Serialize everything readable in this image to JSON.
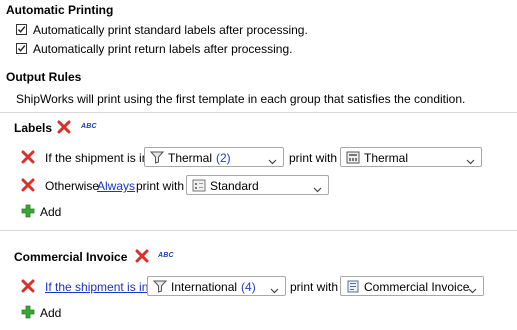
{
  "automatic_printing": {
    "heading": "Automatic Printing",
    "options": [
      {
        "label": "Automatically print standard labels after processing.",
        "checked": true
      },
      {
        "label": "Automatically print return labels after processing.",
        "checked": true
      }
    ]
  },
  "output_rules": {
    "heading": "Output Rules",
    "description": "ShipWorks will print using the first template in each group that satisfies the condition."
  },
  "labels_group": {
    "title": "Labels",
    "rule1": {
      "prefix": "If the shipment is in",
      "filter": "Thermal",
      "filter_count": "(2)",
      "print_with": "print with",
      "template": "Thermal"
    },
    "rule2": {
      "prefix": "Otherwise",
      "condition_link": "Always",
      "print_with": "print with",
      "template": "Standard"
    },
    "add_label": "Add"
  },
  "commercial_group": {
    "title": "Commercial Invoice",
    "rule1": {
      "prefix_link": "If the shipment is in",
      "filter": "International",
      "filter_count": "(4)",
      "print_with": "print with",
      "template": "Commercial Invoice"
    },
    "add_label": "Add"
  },
  "icons": {
    "delete": "red-x-icon",
    "rename": "abc-icon",
    "filter": "funnel-icon",
    "template": "printer-template-icon",
    "add": "green-plus-icon"
  },
  "colors": {
    "delete_red": "#d9302a",
    "add_green": "#3aa635",
    "link_blue": "#1a33c8",
    "count_blue": "#2040c0"
  }
}
